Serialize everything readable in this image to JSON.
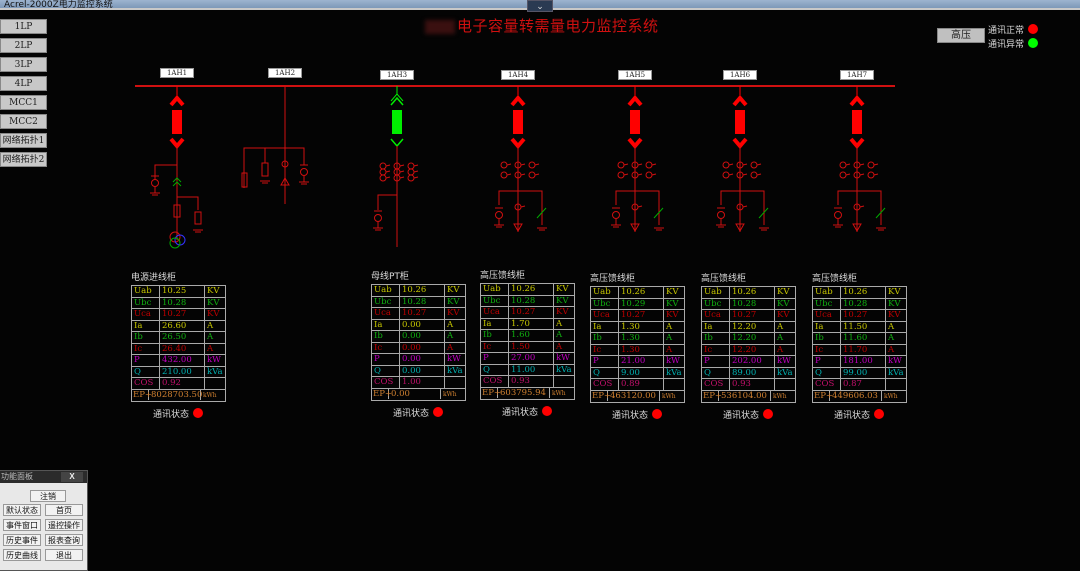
{
  "window": {
    "title": "Acrel-2000Z电力监控系统"
  },
  "header": {
    "title": "电子容量转需量电力监控系统",
    "mode_button": "高压"
  },
  "legend": [
    {
      "label": "通讯正常",
      "color": "#ff0000"
    },
    {
      "label": "通讯异常",
      "color": "#00ff00"
    }
  ],
  "nav": [
    "1LP",
    "2LP",
    "3LP",
    "4LP",
    "MCC1",
    "MCC2",
    "网络拓扑1",
    "网络拓扑2"
  ],
  "colors": {
    "bus": "#d01010",
    "closed": "#ff0000",
    "open": "#00ee00",
    "ua": "#c8c800",
    "ub": "#10b010",
    "uc": "#c00000",
    "p": "#c000c0",
    "q": "#00b0b0",
    "cos": "#c0106a",
    "ep": "#d08030"
  },
  "feeders": [
    {
      "id": "1AH1",
      "type": "incoming",
      "breaker": "closed"
    },
    {
      "id": "1AH2",
      "type": "pt",
      "breaker": "none"
    },
    {
      "id": "1AH3",
      "type": "buspt",
      "breaker": "open"
    },
    {
      "id": "1AH4",
      "type": "outgoing",
      "breaker": "closed"
    },
    {
      "id": "1AH5",
      "type": "outgoing",
      "breaker": "closed"
    },
    {
      "id": "1AH6",
      "type": "outgoing",
      "breaker": "closed"
    },
    {
      "id": "1AH7",
      "type": "outgoing",
      "breaker": "closed"
    }
  ],
  "panels": [
    {
      "title": "电源进线柜",
      "status": "通讯状态",
      "rows": [
        [
          "Uab",
          "10.25",
          "KV"
        ],
        [
          "Ubc",
          "10.28",
          "KV"
        ],
        [
          "Uca",
          "10.27",
          "KV"
        ],
        [
          "Ia",
          "26.60",
          "A"
        ],
        [
          "Ib",
          "26.50",
          "A"
        ],
        [
          "Ic",
          "26.40",
          "A"
        ],
        [
          "P",
          "432.00",
          "kW"
        ],
        [
          "Q",
          "210.00",
          "kVa"
        ],
        [
          "COS",
          "0.92",
          ""
        ]
      ],
      "ep": [
        "EP+",
        "8028703.50",
        "kWh"
      ]
    },
    {
      "title": "母线PT柜",
      "status": "通讯状态",
      "rows": [
        [
          "Uab",
          "10.26",
          "KV"
        ],
        [
          "Ubc",
          "10.28",
          "KV"
        ],
        [
          "Uca",
          "10.27",
          "KV"
        ],
        [
          "Ia",
          "0.00",
          "A"
        ],
        [
          "Ib",
          "0.00",
          "A"
        ],
        [
          "Ic",
          "0.00",
          "A"
        ],
        [
          "P",
          "0.00",
          "kW"
        ],
        [
          "Q",
          "0.00",
          "kVa"
        ],
        [
          "COS",
          "1.00",
          ""
        ]
      ],
      "ep": [
        "EP+",
        "0.00",
        "kWh"
      ]
    },
    {
      "title": "高压馈线柜",
      "status": "通讯状态",
      "rows": [
        [
          "Uab",
          "10.26",
          "KV"
        ],
        [
          "Ubc",
          "10.28",
          "KV"
        ],
        [
          "Uca",
          "10.27",
          "KV"
        ],
        [
          "Ia",
          "1.70",
          "A"
        ],
        [
          "Ib",
          "1.60",
          "A"
        ],
        [
          "Ic",
          "1.50",
          "A"
        ],
        [
          "P",
          "27.00",
          "kW"
        ],
        [
          "Q",
          "11.00",
          "kVa"
        ],
        [
          "COS",
          "0.93",
          ""
        ]
      ],
      "ep": [
        "EP+",
        "603795.94",
        "kWh"
      ]
    },
    {
      "title": "高压馈线柜",
      "status": "通讯状态",
      "rows": [
        [
          "Uab",
          "10.26",
          "KV"
        ],
        [
          "Ubc",
          "10.29",
          "KV"
        ],
        [
          "Uca",
          "10.27",
          "KV"
        ],
        [
          "Ia",
          "1.30",
          "A"
        ],
        [
          "Ib",
          "1.30",
          "A"
        ],
        [
          "Ic",
          "1.30",
          "A"
        ],
        [
          "P",
          "21.00",
          "kW"
        ],
        [
          "Q",
          "9.00",
          "kVa"
        ],
        [
          "COS",
          "0.89",
          ""
        ]
      ],
      "ep": [
        "EP+",
        "463120.00",
        "kWh"
      ]
    },
    {
      "title": "高压馈线柜",
      "status": "通讯状态",
      "rows": [
        [
          "Uab",
          "10.26",
          "KV"
        ],
        [
          "Ubc",
          "10.28",
          "KV"
        ],
        [
          "Uca",
          "10.27",
          "KV"
        ],
        [
          "Ia",
          "12.20",
          "A"
        ],
        [
          "Ib",
          "12.20",
          "A"
        ],
        [
          "Ic",
          "12.20",
          "A"
        ],
        [
          "P",
          "202.00",
          "kW"
        ],
        [
          "Q",
          "89.00",
          "kVa"
        ],
        [
          "COS",
          "0.93",
          ""
        ]
      ],
      "ep": [
        "EP+",
        "536104.00",
        "kWh"
      ]
    },
    {
      "title": "高压馈线柜",
      "status": "通讯状态",
      "rows": [
        [
          "Uab",
          "10.26",
          "KV"
        ],
        [
          "Ubc",
          "10.28",
          "KV"
        ],
        [
          "Uca",
          "10.27",
          "KV"
        ],
        [
          "Ia",
          "11.50",
          "A"
        ],
        [
          "Ib",
          "11.60",
          "A"
        ],
        [
          "Ic",
          "11.70",
          "A"
        ],
        [
          "P",
          "181.00",
          "kW"
        ],
        [
          "Q",
          "99.00",
          "kVa"
        ],
        [
          "COS",
          "0.87",
          ""
        ]
      ],
      "ep": [
        "EP+",
        "449606.03",
        "kWh"
      ]
    }
  ],
  "func_panel": {
    "title": "功能面板",
    "close": "X",
    "buttons": [
      "注销",
      "默认状态",
      "首页",
      "事件窗口",
      "遥控操作",
      "历史事件",
      "报表查询",
      "历史曲线",
      "退出"
    ]
  }
}
